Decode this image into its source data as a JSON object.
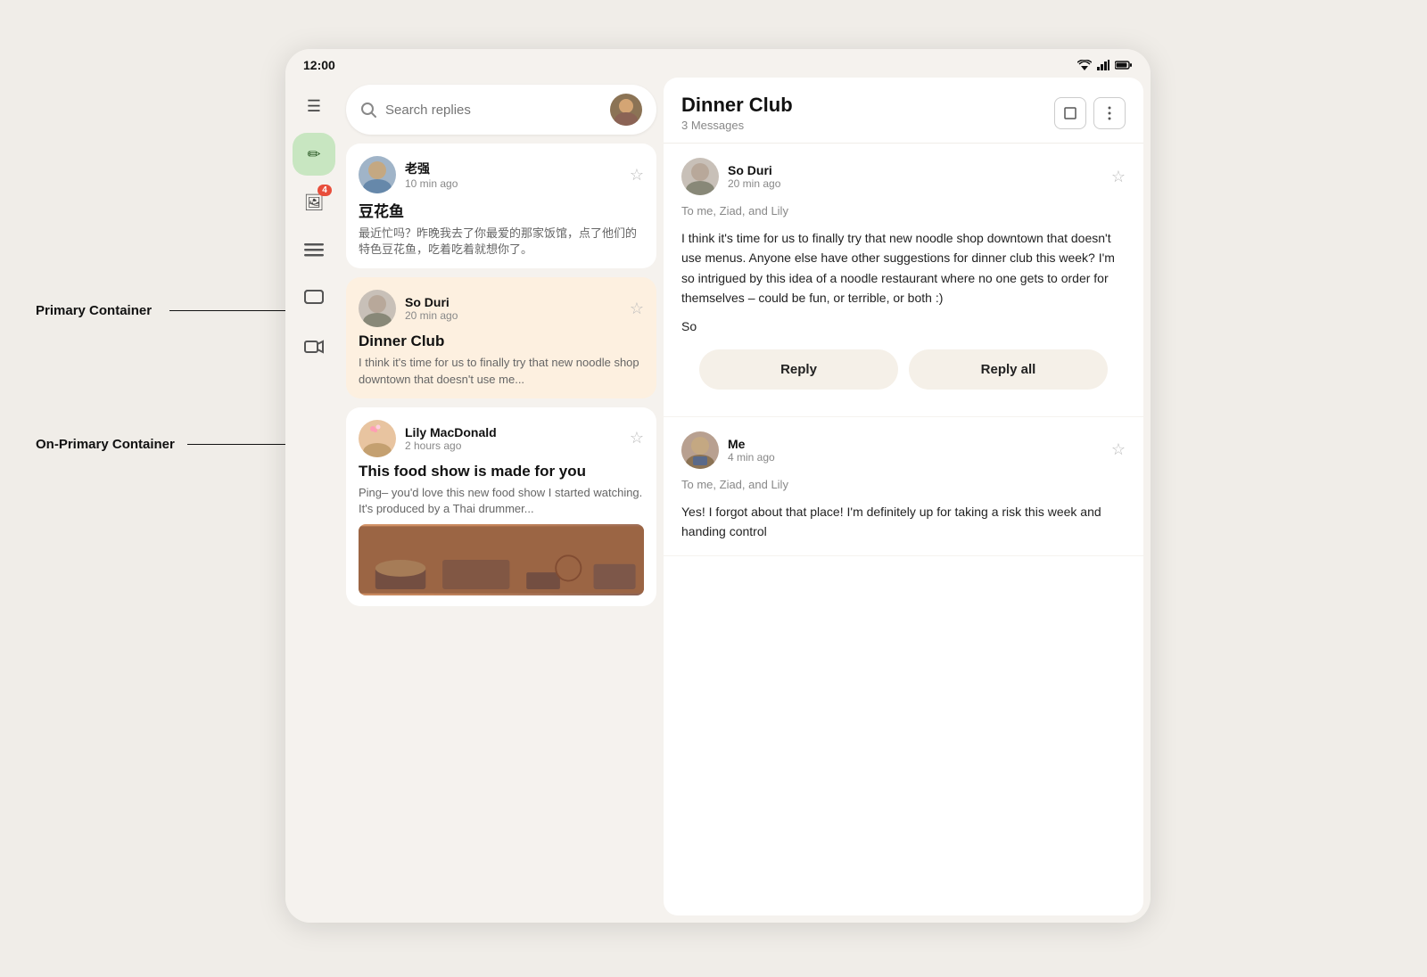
{
  "statusBar": {
    "time": "12:00",
    "icons": [
      "wifi",
      "signal",
      "battery"
    ]
  },
  "nav": {
    "items": [
      {
        "name": "menu",
        "icon": "☰",
        "badge": null
      },
      {
        "name": "compose",
        "icon": "✏",
        "badge": null,
        "active": true
      },
      {
        "name": "inbox",
        "icon": "🖼",
        "badge": "4"
      },
      {
        "name": "list",
        "icon": "☰",
        "badge": null
      },
      {
        "name": "chat",
        "icon": "□",
        "badge": null
      },
      {
        "name": "video",
        "icon": "▶",
        "badge": null
      }
    ]
  },
  "search": {
    "placeholder": "Search replies"
  },
  "emailList": [
    {
      "sender": "老强",
      "time": "10 min ago",
      "subject": "豆花鱼",
      "preview": "最近忙吗？昨晚我去了你最爱的那家饭馆，点了他们的特色豆花鱼，吃着吃着就想你了。",
      "selected": false,
      "avatarClass": "avatar-laobao"
    },
    {
      "sender": "So Duri",
      "time": "20 min ago",
      "subject": "Dinner Club",
      "preview": "I think it's time for us to finally try that new noodle shop downtown that doesn't use me...",
      "selected": true,
      "avatarClass": "avatar-soduri"
    },
    {
      "sender": "Lily MacDonald",
      "time": "2 hours ago",
      "subject": "This food show is made for you",
      "preview": "Ping– you'd love this new food show I started watching. It's produced by a Thai drummer...",
      "selected": false,
      "avatarClass": "avatar-lily",
      "hasImage": true
    }
  ],
  "emailDetail": {
    "title": "Dinner Club",
    "messageCount": "3 Messages",
    "messages": [
      {
        "sender": "So Duri",
        "time": "20 min ago",
        "to": "To me, Ziad, and Lily",
        "body": "I think it's time for us to finally try that new noodle shop downtown that doesn't use menus. Anyone else have other suggestions for dinner club this week? I'm so intrigued by this idea of a noodle restaurant where no one gets to order for themselves – could be fun, or terrible, or both :)",
        "signature": "So",
        "avatarClass": "avatar-soduri"
      },
      {
        "sender": "Me",
        "time": "4 min ago",
        "to": "To me, Ziad, and Lily",
        "body": "Yes! I forgot about that place! I'm definitely up for taking a risk this week and handing control",
        "signature": "",
        "avatarClass": "avatar-me"
      }
    ],
    "replyButton": "Reply",
    "replyAllButton": "Reply all"
  },
  "annotations": {
    "primaryContainer": "Primary Container",
    "onPrimaryContainer": "On-Primary Container"
  }
}
